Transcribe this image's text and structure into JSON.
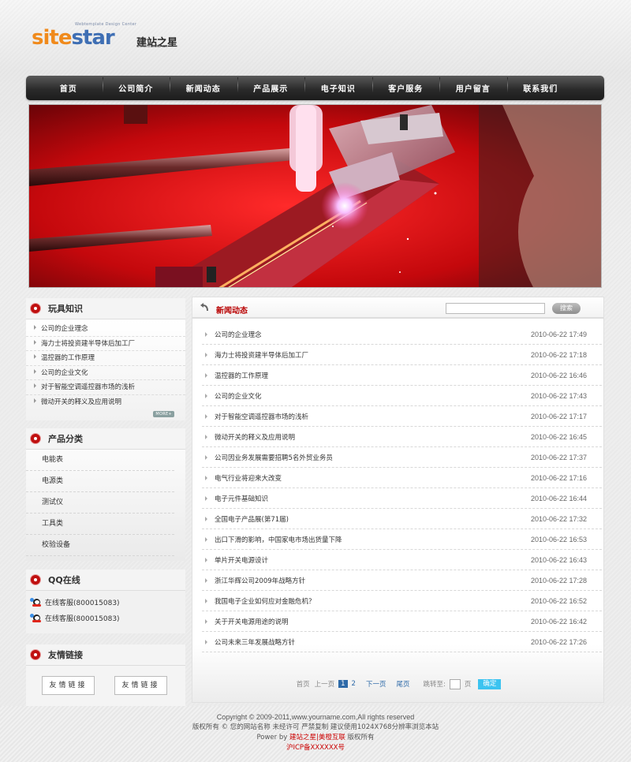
{
  "logo": {
    "sub": "Webtemplate Design Center",
    "main_orange": "site",
    "main_blue": "star",
    "cn": "建站之星",
    "url": "www.sitestar.cn"
  },
  "nav": [
    "首页",
    "公司简介",
    "新闻动态",
    "产品展示",
    "电子知识",
    "客户服务",
    "用户留言",
    "联系我们"
  ],
  "sidebar": {
    "toys": {
      "title": "玩具知识",
      "items": [
        "公司的企业理念",
        "海力士将投资建半导体后加工厂",
        "温控器的工作原理",
        "公司的企业文化",
        "对于智能空调遥控器市场的浅析",
        "微动开关的释义及应用说明"
      ],
      "more": "MORE+"
    },
    "categories": {
      "title": "产品分类",
      "items": [
        "电能表",
        "电源类",
        "测试仪",
        "工具类",
        "校验设备"
      ]
    },
    "qq": {
      "title": "QQ在线",
      "items": [
        "在线客服(800015083)",
        "在线客服(800015083)"
      ]
    },
    "links": {
      "title": "友情链接",
      "items": [
        "友情链接",
        "友情链接"
      ]
    }
  },
  "main": {
    "title": "新闻动态",
    "search_value": "",
    "search_button": "搜索",
    "news": [
      {
        "title": "公司的企业理念",
        "date": "2010-06-22 17:49"
      },
      {
        "title": "海力士将投资建半导体后加工厂",
        "date": "2010-06-22 17:18"
      },
      {
        "title": "温控器的工作原理",
        "date": "2010-06-22 16:46"
      },
      {
        "title": "公司的企业文化",
        "date": "2010-06-22 17:43"
      },
      {
        "title": "对于智能空调遥控器市场的浅析",
        "date": "2010-06-22 17:17"
      },
      {
        "title": "微动开关的释义及应用说明",
        "date": "2010-06-22 16:45"
      },
      {
        "title": "公司因业务发展需要招聘5名外贸业务员",
        "date": "2010-06-22 17:37"
      },
      {
        "title": "电气行业将迎来大改变",
        "date": "2010-06-22 17:16"
      },
      {
        "title": "电子元件基础知识",
        "date": "2010-06-22 16:44"
      },
      {
        "title": "全国电子产品展(第71届)",
        "date": "2010-06-22 17:32"
      },
      {
        "title": "出口下滑的影响，中国家电市场出货量下降",
        "date": "2010-06-22 16:53"
      },
      {
        "title": "单片开关电源设计",
        "date": "2010-06-22 16:43"
      },
      {
        "title": "浙江华辉公司2009年战略方针",
        "date": "2010-06-22 17:28"
      },
      {
        "title": "我国电子企业如何应对金融危机？",
        "date": "2010-06-22 16:52"
      },
      {
        "title": "关于开关电源用途的说明",
        "date": "2010-06-22 16:42"
      },
      {
        "title": "公司未来三年发展战略方针",
        "date": "2010-06-22 17:26"
      }
    ],
    "pager": {
      "first": "首页",
      "prev": "上一页",
      "current": "1",
      "page2": "2",
      "next": "下一页",
      "last": "尾页",
      "jump_label": "跳转至:",
      "page_unit": "页",
      "go": "确定"
    }
  },
  "footer": {
    "copyright": "Copyright © 2009-2011,www.yourname.com,All rights reserved",
    "line2": "版权所有 © 您的网站名称 未经许可 严禁复制 建议使用1024X768分辨率浏览本站",
    "power_prefix": "Power by",
    "power_link": "建站之星|美橙互联",
    "power_suffix": "版权所有",
    "icp": "沪ICP备XXXXXX号"
  }
}
